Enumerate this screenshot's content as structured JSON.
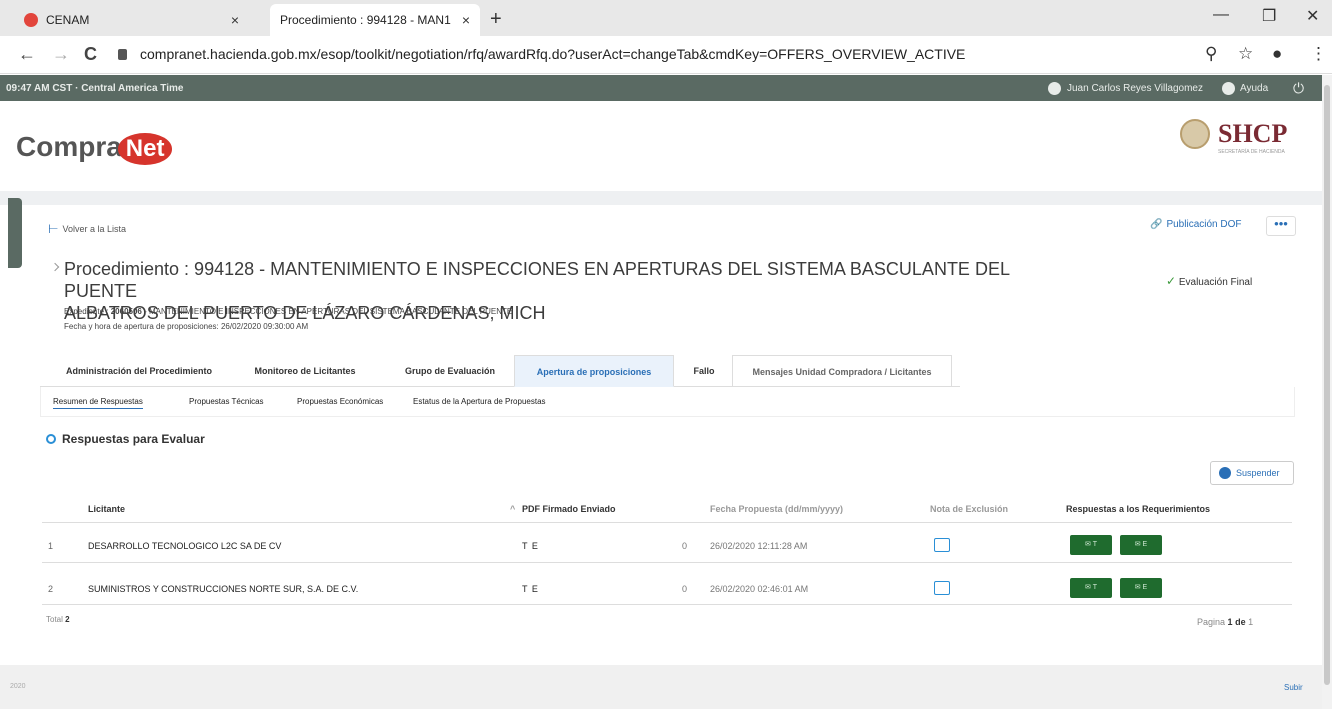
{
  "browser": {
    "tabs": [
      {
        "label": "CENAM",
        "close": "×"
      },
      {
        "label": "Procedimiento : 994128 - MAN1",
        "close": "×"
      }
    ],
    "new_tab": "+",
    "window_controls": {
      "minimize": "—",
      "maximize": "❐",
      "close": "✕"
    },
    "nav": {
      "back": "←",
      "forward": "→",
      "reload": "C"
    },
    "url": "compranet.hacienda.gob.mx/esop/toolkit/negotiation/rfq/awardRfq.do?userAct=changeTab&cmdKey=OFFERS_OVERVIEW_ACTIVE",
    "icons": {
      "zoom": "⚲",
      "star": "☆",
      "profile": "●",
      "menu": "⋮"
    }
  },
  "appbar": {
    "time": "09:47 AM CST · Central America Time",
    "user": "Juan Carlos Reyes Villagomez",
    "help": "Ayuda",
    "power": "⏻"
  },
  "header": {
    "logo_text": "Compra",
    "logo_accent": "Net",
    "shcp": "SHCP",
    "shcp_sub": "SECRETARÍA DE HACIENDA"
  },
  "page": {
    "back_link": "Volver a la Lista",
    "publicacion": "Publicación DOF",
    "more": "•••",
    "title_line1": "Procedimiento : 994128 - MANTENIMIENTO E INSPECCIONES EN APERTURAS DEL SISTEMA BASCULANTE DEL PUENTE",
    "title_line2": "ALBATROS DEL PUERTO DE LÁZARO CÁRDENAS, MICH",
    "status": "Evaluación Final",
    "expediente_label": "Expediente :",
    "expediente_value": "2060506",
    "expediente_desc": " - MANTENIMIENTO E INSPECCIONES EN APERTURAS DEL SISTEMA BASCULANTE DEL PUENTE",
    "fecha": "Fecha y hora de apertura de proposiciones: 26/02/2020 09:30:00 AM"
  },
  "tabs": [
    "Administración del Procedimiento",
    "Monitoreo de Licitantes",
    "Grupo de Evaluación",
    "Apertura de proposiciones",
    "Fallo",
    "Mensajes Unidad Compradora / Licitantes"
  ],
  "subtabs": [
    "Resumen de Respuestas",
    "Propuestas Técnicas",
    "Propuestas Económicas",
    "Estatus de la Apertura de Propuestas"
  ],
  "section": {
    "title": "Respuestas para Evaluar",
    "suspend": "Suspender"
  },
  "table": {
    "headers": {
      "licitante": "Licitante",
      "pdf": "PDF Firmado Enviado",
      "fecha": "Fecha Propuesta (dd/mm/yyyy)",
      "nota": "Nota de Exclusión",
      "respuestas": "Respuestas a los Requerimientos"
    },
    "rows": [
      {
        "num": "1",
        "licitante": "DESARROLLO TECNOLOGICO L2C SA DE CV",
        "pdf": "T E",
        "count": "0",
        "fecha": "26/02/2020 12:11:28 AM",
        "btn1": "✉ T",
        "btn2": "✉ E"
      },
      {
        "num": "2",
        "licitante": "SUMINISTROS Y CONSTRUCCIONES NORTE SUR, S.A. DE C.V.",
        "pdf": "T E",
        "count": "0",
        "fecha": "26/02/2020 02:46:01 AM",
        "btn1": "✉ T",
        "btn2": "✉ E"
      }
    ],
    "total_label": "Total",
    "total_value": "2",
    "pagina_label": "Pagina",
    "pagina_current": "1",
    "pagina_de": "de",
    "pagina_total": "1"
  },
  "footer": {
    "year": "2020",
    "subir": "Subir"
  }
}
